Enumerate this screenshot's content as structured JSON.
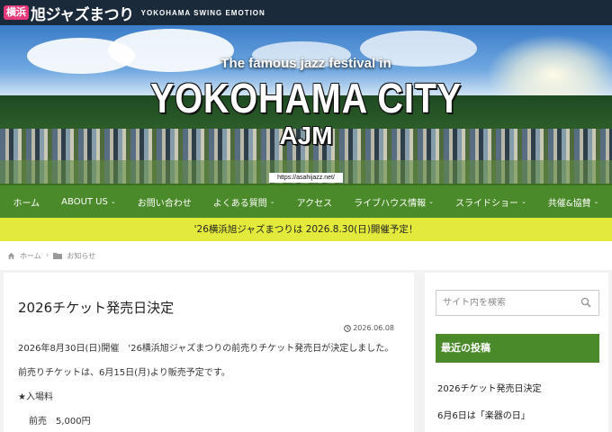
{
  "site": {
    "logo_badge": "横浜",
    "logo_text": "旭ジャズまつり",
    "logo_sub": "YOKOHAMA SWING EMOTION"
  },
  "hero": {
    "tagline": "The famous jazz festival in",
    "title": "YOKOHAMA CITY",
    "abbr": "AJM",
    "url": "https://asahijazz.net/"
  },
  "nav": {
    "items": [
      {
        "label": "ホーム",
        "has_dropdown": false
      },
      {
        "label": "ABOUT US",
        "has_dropdown": true
      },
      {
        "label": "お問い合わせ",
        "has_dropdown": false
      },
      {
        "label": "よくある質問",
        "has_dropdown": true
      },
      {
        "label": "アクセス",
        "has_dropdown": false
      },
      {
        "label": "ライブハウス情報",
        "has_dropdown": true
      },
      {
        "label": "スライドショー",
        "has_dropdown": true
      },
      {
        "label": "共催&協賛",
        "has_dropdown": true
      }
    ]
  },
  "notice": {
    "text": "'26横浜旭ジャズまつりは 2026.8.30(日)開催予定！"
  },
  "breadcrumb": {
    "home": "ホーム",
    "category": "お知らせ"
  },
  "article": {
    "title": "2026チケット発売日決定",
    "date": "2026.06.08",
    "p1": "2026年8月30日(日)開催　'26横浜旭ジャズまつりの前売りチケット発売日が決定しました。",
    "p2": "前売りチケットは、6月15日(月)より販売予定です。",
    "p3": "★入場料",
    "p4": "前売　5,000円"
  },
  "sidebar": {
    "search_placeholder": "サイト内を検索",
    "recent_heading": "最近の投稿",
    "recent_posts": [
      "2026チケット発売日決定",
      "6月6日は「楽器の日」"
    ]
  },
  "colors": {
    "topbar": "#1b2a3a",
    "nav_green": "#4b8a2a",
    "notice_yellow": "#e3ea3c",
    "badge_pink": "#e6397a"
  }
}
